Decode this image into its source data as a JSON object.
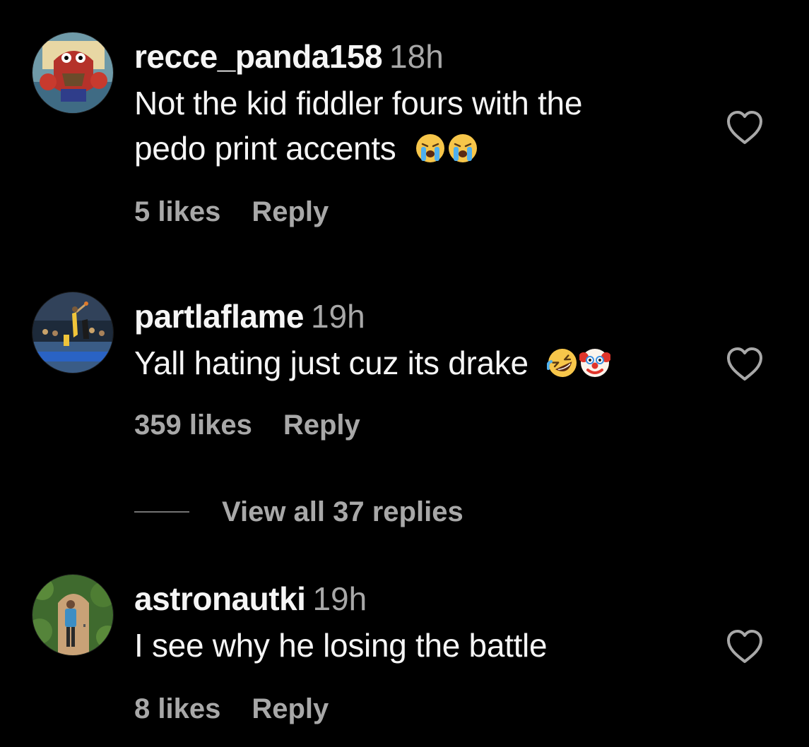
{
  "comments": [
    {
      "username": "recce_panda158",
      "time": "18h",
      "text_lines": [
        "Not the kid fiddler fours with the",
        "pedo print accents"
      ],
      "emojis": [
        "loudly-crying-face",
        "loudly-crying-face"
      ],
      "likes": "5 likes",
      "reply": "Reply",
      "avatar": "cartoon-crab-avatar"
    },
    {
      "username": "partlaflame",
      "time": "19h",
      "text_lines": [
        "Yall hating just cuz its drake"
      ],
      "emojis": [
        "rolling-on-floor-laughing",
        "clown-face"
      ],
      "likes": "359 likes",
      "reply": "Reply",
      "avatar": "basketball-arena-avatar"
    },
    {
      "username": "astronautki",
      "time": "19h",
      "text_lines": [
        "I see why he losing the battle"
      ],
      "emojis": [],
      "likes": "8 likes",
      "reply": "Reply",
      "avatar": "person-in-garden-avatar"
    }
  ],
  "view_replies": "View all 37 replies",
  "icons": {
    "like": "heart-outline-icon"
  },
  "colors": {
    "background": "#000000",
    "primary_text": "#f5f5f5",
    "secondary_text": "#a8a8a8"
  }
}
